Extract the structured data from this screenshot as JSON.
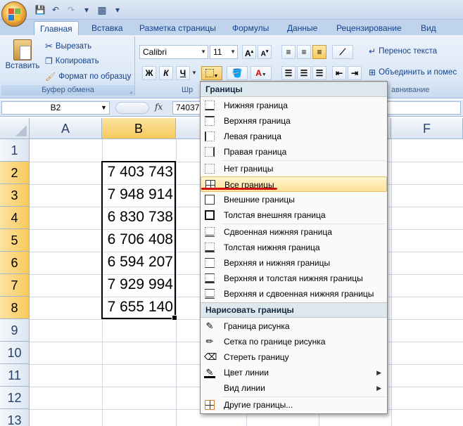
{
  "qat": {
    "save": "💾",
    "undo": "↶",
    "redo": "↷",
    "customize": "▾"
  },
  "tabs": [
    {
      "label": "Главная",
      "active": true
    },
    {
      "label": "Вставка"
    },
    {
      "label": "Разметка страницы"
    },
    {
      "label": "Формулы"
    },
    {
      "label": "Данные"
    },
    {
      "label": "Рецензирование"
    },
    {
      "label": "Вид"
    }
  ],
  "clipboard": {
    "paste_label": "Вставить",
    "cut_label": "Вырезать",
    "copy_label": "Копировать",
    "format_painter_label": "Формат по образцу",
    "group_label": "Буфер обмена"
  },
  "font": {
    "name": "Calibri",
    "size": "11",
    "grow": "A",
    "shrink": "A",
    "bold": "Ж",
    "italic": "К",
    "underline": "Ч",
    "group_label": "Шр"
  },
  "alignment": {
    "wrap_label": "Перенос текста",
    "merge_label": "Объединить и помес",
    "group_label": "авнивание"
  },
  "formula_bar": {
    "name_box": "B2",
    "fx": "fx",
    "value": "74037"
  },
  "grid": {
    "columns": [
      "A",
      "B",
      "C",
      "D",
      "E",
      "F"
    ],
    "rows": [
      "1",
      "2",
      "3",
      "4",
      "5",
      "6",
      "7",
      "8",
      "9",
      "10",
      "11",
      "12",
      "13"
    ],
    "b_values": [
      "7 403 743",
      "7 948 914",
      "6 830 738",
      "6 706 408",
      "6 594 207",
      "7 929 994",
      "7 655 140"
    ]
  },
  "menu": {
    "header_borders": "Границы",
    "items": [
      "Нижняя граница",
      "Верхняя граница",
      "Левая граница",
      "Правая граница",
      "Нет границы",
      "Все границы",
      "Внешние границы",
      "Толстая внешняя граница",
      "Сдвоенная нижняя граница",
      "Толстая нижняя граница",
      "Верхняя и нижняя границы",
      "Верхняя и толстая нижняя границы",
      "Верхняя и сдвоенная нижняя границы"
    ],
    "header_draw": "Нарисовать границы",
    "draw_items": [
      "Граница рисунка",
      "Сетка по границе рисунка",
      "Стереть границу",
      "Цвет линии",
      "Вид линии",
      "Другие границы..."
    ],
    "highlight_color": "#fde19a"
  }
}
